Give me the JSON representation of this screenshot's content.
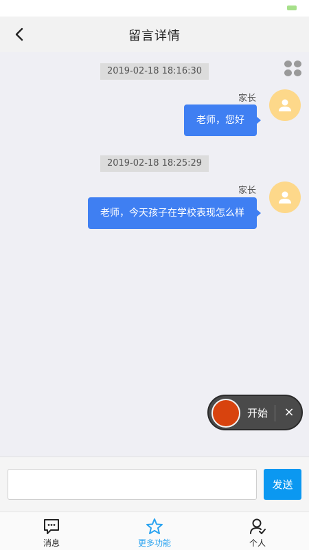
{
  "header": {
    "title": "留言详情"
  },
  "messages": [
    {
      "time": "2019-02-18 18:16:30",
      "sender": "家长",
      "text": "老师，您好"
    },
    {
      "time": "2019-02-18 18:25:29",
      "sender": "家长",
      "text": "老师，今天孩子在学校表现怎么样"
    }
  ],
  "recorder": {
    "label": "开始",
    "close": "×"
  },
  "input": {
    "value": "",
    "placeholder": ""
  },
  "send": {
    "label": "发送"
  },
  "tabs": [
    {
      "label": "消息",
      "icon": "message-icon",
      "active": false
    },
    {
      "label": "更多功能",
      "icon": "star-icon",
      "active": true
    },
    {
      "label": "个人",
      "icon": "person-icon",
      "active": false
    }
  ],
  "colors": {
    "bubble": "#3f7ff2",
    "avatar": "#fdd88a",
    "send_button": "#0b98f1",
    "active_tab": "#2aa3f0",
    "record_button": "#d8430e"
  }
}
